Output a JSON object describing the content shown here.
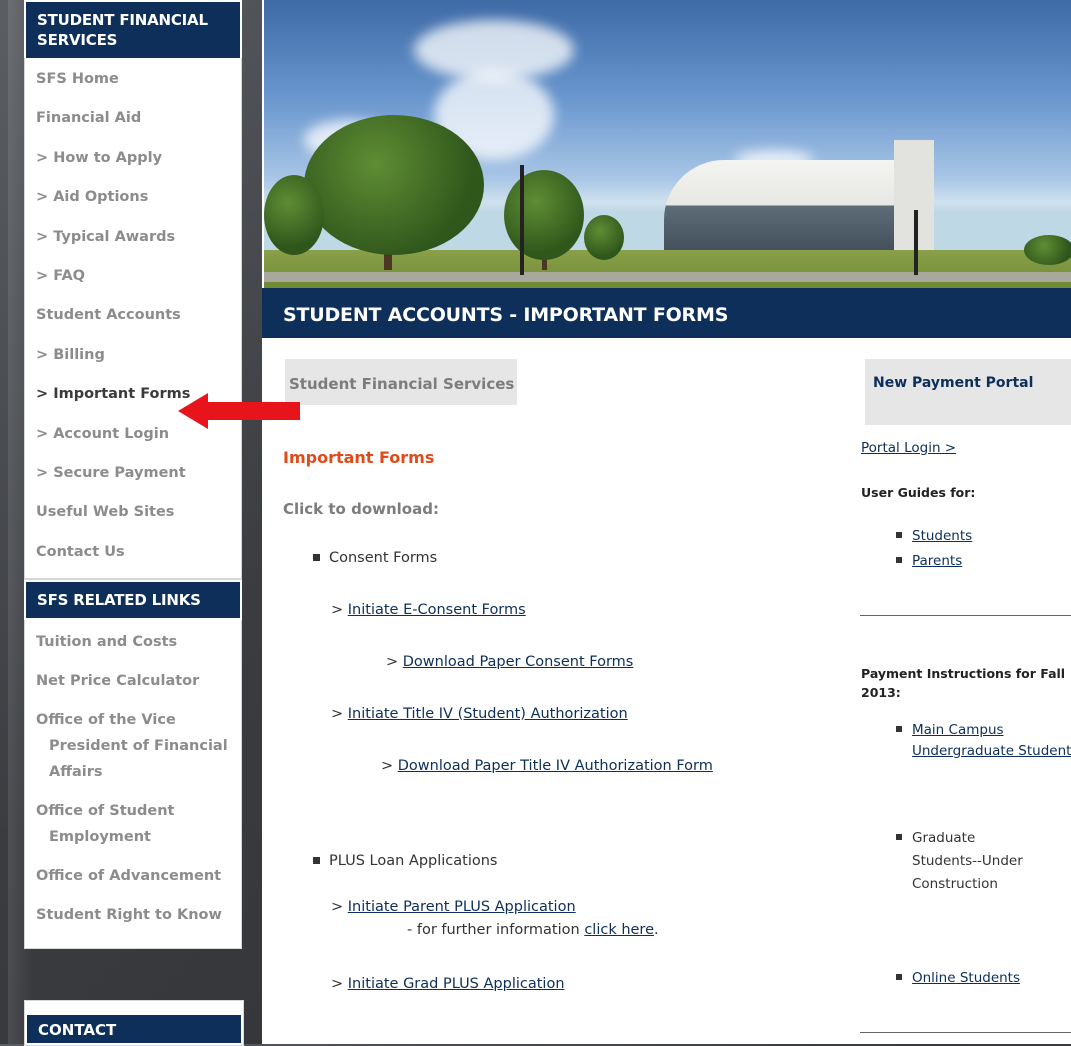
{
  "sidebar": {
    "header": "STUDENT FINANCIAL SERVICES",
    "items": [
      {
        "label": "SFS Home"
      },
      {
        "label": "Financial Aid"
      },
      {
        "label": "> How to Apply"
      },
      {
        "label": "> Aid Options"
      },
      {
        "label": "> Typical Awards"
      },
      {
        "label": "> FAQ"
      },
      {
        "label": "Student Accounts"
      },
      {
        "label": "> Billing"
      },
      {
        "label": "> Important Forms"
      },
      {
        "label": "> Account Login"
      },
      {
        "label": "> Secure Payment"
      },
      {
        "label": "Useful Web Sites"
      },
      {
        "label": "Contact Us"
      }
    ],
    "related_header": "SFS RELATED LINKS",
    "related": [
      {
        "line1": "Tuition and Costs",
        "line2": ""
      },
      {
        "line1": "Net Price Calculator",
        "line2": ""
      },
      {
        "line1": "Office of the Vice",
        "line2": "President of Financial Affairs"
      },
      {
        "line1": "Office of Student",
        "line2": "Employment"
      },
      {
        "line1": "Office of Advancement",
        "line2": ""
      },
      {
        "line1": "Student Right to Know",
        "line2": ""
      }
    ],
    "contact_header": "CONTACT"
  },
  "page": {
    "title": "STUDENT ACCOUNTS - IMPORTANT FORMS",
    "sfs_box": "Student Financial Services",
    "section_title": "Important Forms",
    "click_download": "Click to download:",
    "consent": {
      "label": "Consent Forms",
      "prefix": ">",
      "e_consent": "Initiate E-Consent Forms",
      "paper_consent": "Download Paper Consent Forms",
      "title_iv": "Initiate Title IV (Student) Authorization",
      "paper_title_iv": "Download Paper Title IV Authorization Form"
    },
    "plus": {
      "label": "PLUS Loan Applications",
      "parent": "Initiate Parent PLUS Application",
      "further_prefix": "- for further information",
      "click_here": "click here",
      "further_suffix": ".",
      "grad": "Initiate Grad PLUS Application"
    }
  },
  "right": {
    "box_title": "New Payment Portal",
    "portal_login": "Portal Login >",
    "user_guides": "User Guides for:",
    "students": "Students",
    "parents": "Parents",
    "payment_instructions_line1": "Payment Instructions for Fall",
    "payment_instructions_line2": "2013:",
    "main_campus": "Main Campus",
    "undergrad": "Undergraduate Students",
    "graduate_line1": "Graduate",
    "graduate_line2": "Students--Under",
    "graduate_line3": "Construction",
    "online": "Online Students"
  },
  "colors": {
    "navy": "#0d2f5a",
    "accent_orange": "#e14b1a",
    "annotation_arrow": "#e8141b"
  }
}
